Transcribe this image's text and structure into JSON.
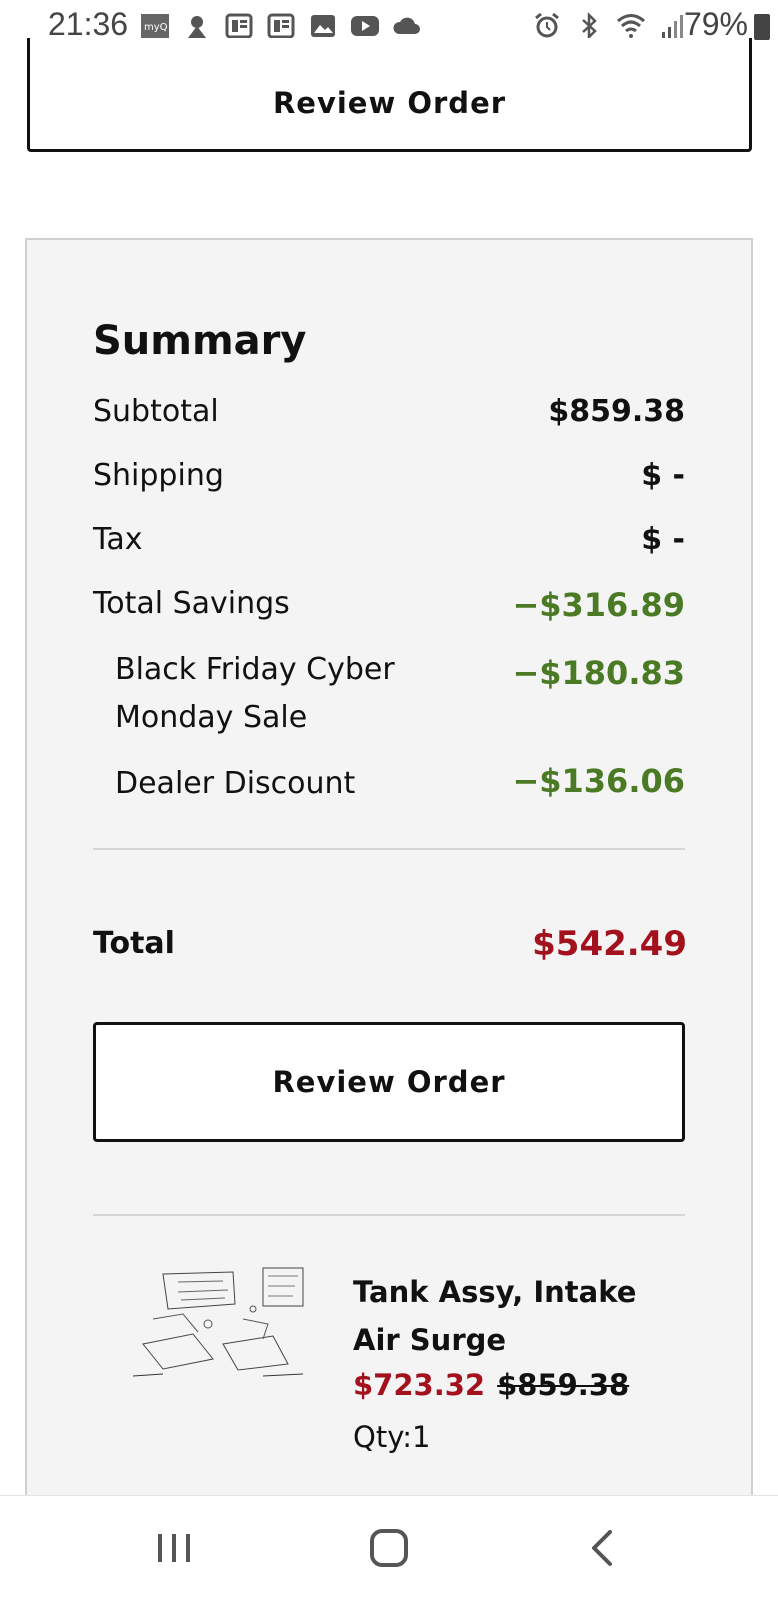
{
  "status_bar": {
    "time": "21:36",
    "battery": "79%",
    "icons": [
      "myq-icon",
      "notification-icon",
      "news-icon",
      "news-icon",
      "gallery-icon",
      "youtube-icon",
      "cloud-icon",
      "alarm-icon",
      "bluetooth-icon",
      "wifi-icon",
      "signal-icon",
      "battery-icon"
    ]
  },
  "top_button": {
    "label": "Review Order"
  },
  "summary": {
    "title": "Summary",
    "subtotal_label": "Subtotal",
    "subtotal_value": "$859.38",
    "shipping_label": "Shipping",
    "shipping_value": "$ -",
    "tax_label": "Tax",
    "tax_value": "$ -",
    "savings_label": "Total Savings",
    "savings_value": "−$316.89",
    "discounts": [
      {
        "label": "Black Friday Cyber Monday Sale",
        "value": "−$180.83"
      },
      {
        "label": "Dealer Discount",
        "value": "−$136.06"
      }
    ],
    "total_label": "Total",
    "total_value": "$542.49",
    "review_button": "Review Order",
    "colors": {
      "savings": "#4a7a23",
      "total": "#a3121c"
    }
  },
  "product": {
    "name": "Tank Assy, Intake Air Surge",
    "sale_price": "$723.32",
    "original_price": "$859.38",
    "quantity": "Qty:1"
  },
  "nav_bar": {
    "buttons": [
      "recent-apps-icon",
      "home-icon",
      "back-icon"
    ]
  }
}
